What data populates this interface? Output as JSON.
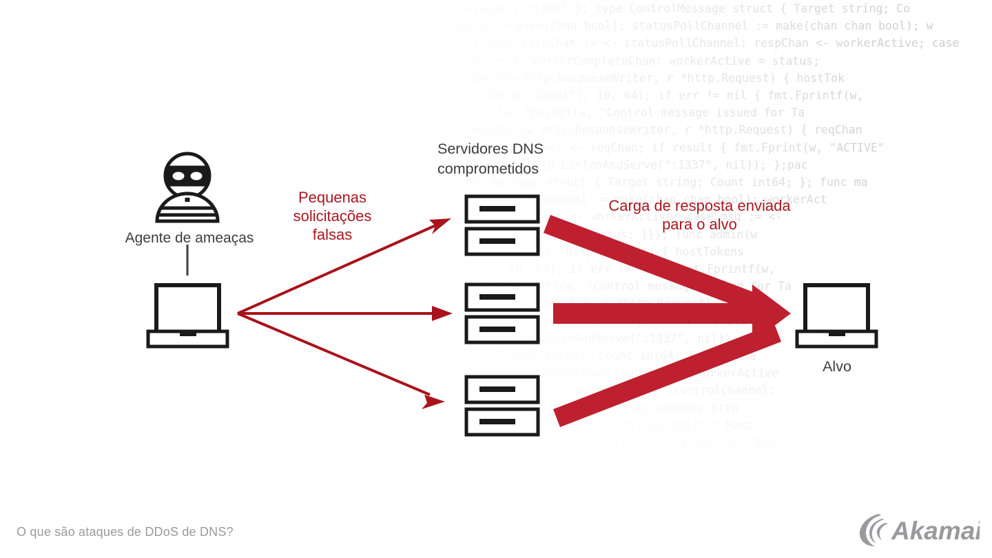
{
  "diagram": {
    "title_caption": "O que são ataques de DDoS de DNS?",
    "brand": "Akamai",
    "accent_red_thin": "#a8131c",
    "accent_red_thick": "#be2030",
    "label_red": "#a9171f",
    "text_gray": "#3d3d3f",
    "caption_gray": "#9a9a9e",
    "icon_black": "#1a1a1a",
    "background": "#ffffff"
  },
  "nodes": {
    "threat_actor": {
      "label": "Agente de ameaças",
      "icon": "burglar-icon",
      "device_icon": "laptop-icon"
    },
    "dns_servers": {
      "label": "Servidores DNS\ncomprometidos",
      "icon": "server-stack-icon",
      "count": 3
    },
    "target": {
      "label": "Alvo",
      "device_icon": "laptop-icon"
    }
  },
  "flows": [
    {
      "name": "small-spoofed-requests",
      "label": "Pequenas\nsolicitações\nfalsas",
      "from": "threat_actor",
      "to": "dns_servers",
      "style": "thin-arrow",
      "color": "#a8131c",
      "count": 3
    },
    {
      "name": "response-payload-to-target",
      "label": "Carga de resposta enviada\npara o alvo",
      "from": "dns_servers",
      "to": "target",
      "style": "thick-arrow",
      "color": "#be2030",
      "count": 3
    }
  ],
  "background_code": {
    "language": "go",
    "lines": [
      "const = \"message\", \"time\" }; type ControlMessage struct { Target string; Co",
      "workerCompleteChan = make(chan bool); statusPollChannel := make(chan chan bool); w",
      "for { select { case respChan := <- statusPollChannel: respChan <- workerActive; case",
      "case status := <- workerCompleteChan: workerActive = status;",
      "func admin(w http.ResponseWriter, r *http.Request) { hostTok",
      "ParseInt(r.FormValue(\"Count\"), 10, 64); if err != nil { fmt.Fprintf(w,",
      "return; }; fmt.Fprintf(w, \"Control message issued for Ta",
      "func statusHandler(w http.ResponseWriter, r *http.Request) { reqChan",
      "statusPollChannel <- reqChan; if result { fmt.Fprint(w, \"ACTIVE\"",
      "log.Fatal(http.ListenAndServe(\":1337\", nil)); };pac",
      "type ControlMessage struct { Target string; Count int64; }; func ma",
      "statusPollChannel := make(chan chan bool); workerAct",
      "respChan <- workerActive; case msg := <-",
      "workerActive = status; }}}; func admin(w",
      "r *http.Request) { hostTokens",
      "10, 64); if err != nil { fmt.Fprintf(w,",
      "fmt.Fprintf(w, \"Control message issued for Ta",
      "http.ResponseWriter, r *http.Request) { reqChan",
      "if result { fmt.Fprint(w, \"ACTIVE\"",
      "ListenAndServe(\":1337\", nil)); };pac",
      "Target string; Count int64; }; func ma",
      "make(chan chan bool); workerActive",
      "case msg := <- controlChannel:",
      "status; }}}; func admin(w http",
      "hostTokens := strings.Split(r.Host",
      "err != nil { fmt.Fprintf(w, \"Bad",
      "issued for Target %s, count"
    ]
  }
}
